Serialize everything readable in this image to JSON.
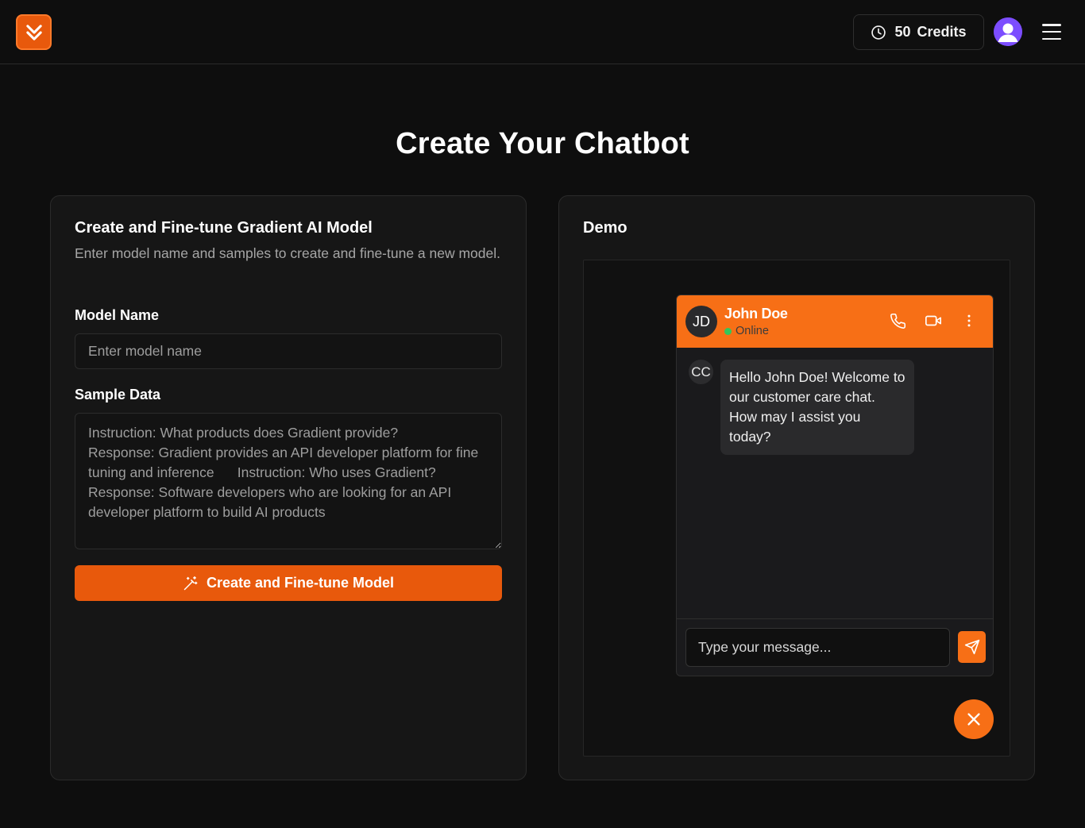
{
  "header": {
    "logo_icon": "chevrons-down-icon",
    "credits_count": "50",
    "credits_label": "Credits",
    "credits_icon": "clock-icon",
    "avatar_icon": "user-avatar-icon",
    "menu_icon": "hamburger-menu-icon"
  },
  "page": {
    "title": "Create Your Chatbot"
  },
  "form": {
    "title": "Create and Fine-tune Gradient AI Model",
    "description": "Enter model name and samples to create and fine-tune a new model.",
    "model_name_label": "Model Name",
    "model_name_placeholder": "Enter model name",
    "sample_data_label": "Sample Data",
    "sample_data_placeholder": "Instruction: What products does Gradient provide?\nResponse: Gradient provides an API developer platform for fine tuning and inference      Instruction: Who uses Gradient?\nResponse: Software developers who are looking for an API developer platform to build AI products",
    "submit_label": "Create and Fine-tune Model",
    "submit_icon": "magic-wand-icon"
  },
  "demo": {
    "title": "Demo",
    "chat": {
      "contact_initials": "JD",
      "contact_name": "John Doe",
      "contact_status": "Online",
      "actions": [
        "phone-icon",
        "video-icon",
        "more-vertical-icon"
      ],
      "messages": [
        {
          "sender_initials": "CC",
          "text": "Hello John Doe! Welcome to our customer care chat. How may I assist you today?"
        }
      ],
      "input_placeholder": "Type your message...",
      "send_icon": "send-icon",
      "close_icon": "close-icon"
    }
  },
  "colors": {
    "accent": "#e8590c",
    "chat_accent": "#f76f16",
    "background": "#0e0e0e",
    "card": "#161616",
    "online": "#33c65b",
    "avatar": "#7c4dff"
  }
}
